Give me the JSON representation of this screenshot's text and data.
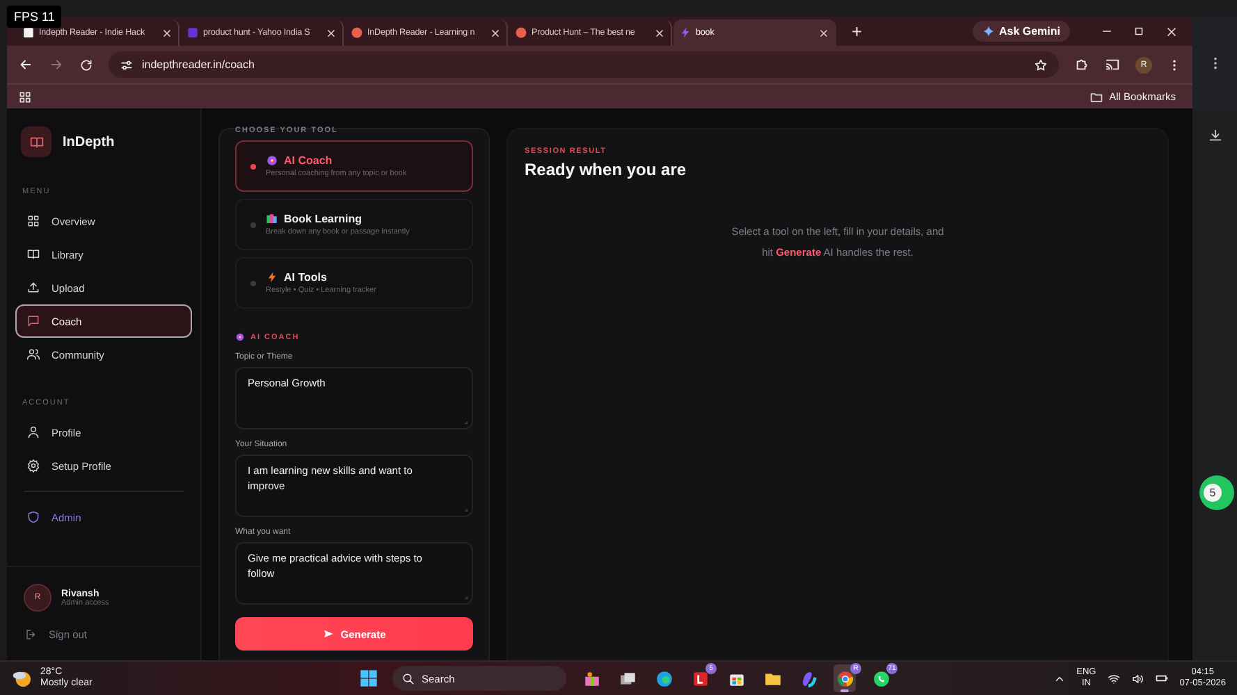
{
  "overlay": {
    "fps": "FPS 11"
  },
  "browser": {
    "tabs": [
      {
        "title": "Indepth Reader - Indie Hack",
        "selected": false
      },
      {
        "title": "product hunt - Yahoo India S",
        "selected": false
      },
      {
        "title": "InDepth Reader - Learning n",
        "selected": false
      },
      {
        "title": "Product Hunt – The best ne",
        "selected": false
      },
      {
        "title": "book",
        "selected": true
      }
    ],
    "new_tab": "+",
    "ask_gemini": "Ask Gemini",
    "url": "indepthreader.in/coach",
    "profile": "R",
    "bookmarks": "All Bookmarks"
  },
  "sidebar": {
    "brand": "InDepth",
    "menu_heading": "MENU",
    "menu": [
      {
        "label": "Overview",
        "selected": false
      },
      {
        "label": "Library",
        "selected": false
      },
      {
        "label": "Upload",
        "selected": false
      },
      {
        "label": "Coach",
        "selected": true
      },
      {
        "label": "Community",
        "selected": false
      }
    ],
    "account_heading": "ACCOUNT",
    "account": [
      {
        "label": "Profile",
        "kind": "link"
      },
      {
        "label": "Setup Profile",
        "kind": "link"
      },
      {
        "label": "Admin",
        "kind": "admin"
      }
    ],
    "user": {
      "initial": "R",
      "name": "Rivansh",
      "role": "Admin access"
    },
    "sign_out": "Sign out"
  },
  "tool_panel": {
    "heading": "CHOOSE YOUR TOOL",
    "tools": [
      {
        "name": "AI Coach",
        "description": "Personal coaching from any topic or book",
        "selected": true
      },
      {
        "name": "Book Learning",
        "description": "Break down any book or passage instantly",
        "selected": false
      },
      {
        "name": "AI Tools",
        "description": "Restyle • Quiz • Learning tracker",
        "selected": false
      }
    ],
    "section": "AI COACH",
    "fields": [
      {
        "label": "Topic or Theme",
        "value": "Personal Growth"
      },
      {
        "label": "Your Situation",
        "value": "I am learning new skills and want to improve"
      },
      {
        "label": "What you want",
        "value": "Give me practical advice with steps to follow"
      }
    ],
    "submit": "Generate"
  },
  "result": {
    "eyebrow": "SESSION RESULT",
    "title": "Ready when you are",
    "hint": "Select a tool on the left, fill in your details, and hit **Generate**  AI handles the rest."
  },
  "side_window": {
    "badge": "5"
  },
  "taskbar": {
    "weather": {
      "temp": "28°C",
      "condition": "Mostly clear"
    },
    "search": "Search",
    "apps": [
      {
        "active": false
      },
      {
        "active": false
      },
      {
        "active": false
      },
      {
        "badge": "5",
        "active": false
      },
      {
        "active": false
      },
      {
        "active": false
      },
      {
        "active": false
      },
      {
        "badge": "R",
        "active": true
      },
      {
        "badge": "71",
        "active": false
      }
    ],
    "language": "ENG",
    "region": "IN",
    "time": "04:15",
    "date": "07-05-2026"
  }
}
